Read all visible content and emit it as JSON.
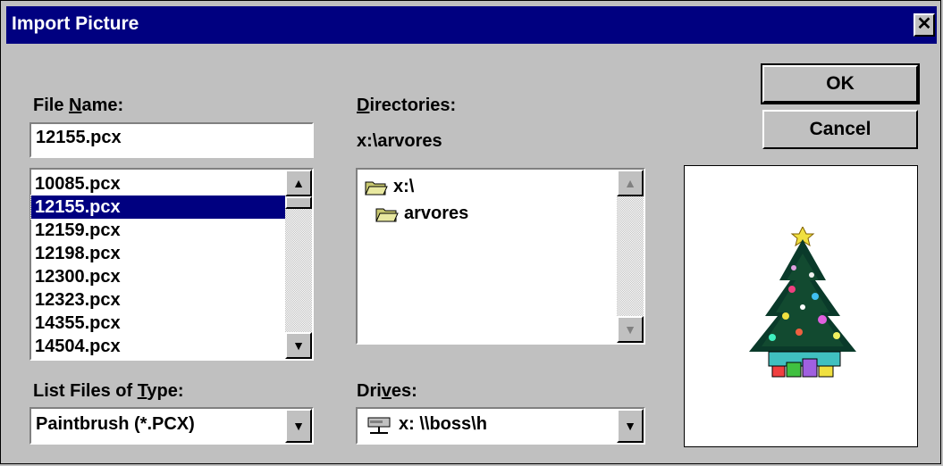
{
  "window": {
    "title": "Import Picture",
    "close_glyph": "✕"
  },
  "file_name": {
    "label_pre": "File ",
    "label_u": "N",
    "label_post": "ame:",
    "value": "12155.pcx",
    "files": [
      "10085.pcx",
      "12155.pcx",
      "12159.pcx",
      "12198.pcx",
      "12300.pcx",
      "12323.pcx",
      "14355.pcx",
      "14504.pcx"
    ],
    "selected_index": 1
  },
  "directories": {
    "label_u": "D",
    "label_post": "irectories:",
    "current_path": "x:\\arvores",
    "items": [
      "x:\\",
      "arvores"
    ]
  },
  "file_type": {
    "label_pre": "List Files of ",
    "label_u": "T",
    "label_post": "ype:",
    "value": "Paintbrush (*.PCX)"
  },
  "drives": {
    "label_pre": "Dri",
    "label_u": "v",
    "label_post": "es:",
    "value": "x: \\\\boss\\h"
  },
  "buttons": {
    "ok": "OK",
    "cancel": "Cancel"
  },
  "icons": {
    "folder": "folder-icon",
    "network_drive": "network-drive-icon",
    "arrow_up": "▲",
    "arrow_down": "▼"
  },
  "colors": {
    "selection": "#000080",
    "titlebar": "#000080",
    "face": "#c0c0c0"
  }
}
